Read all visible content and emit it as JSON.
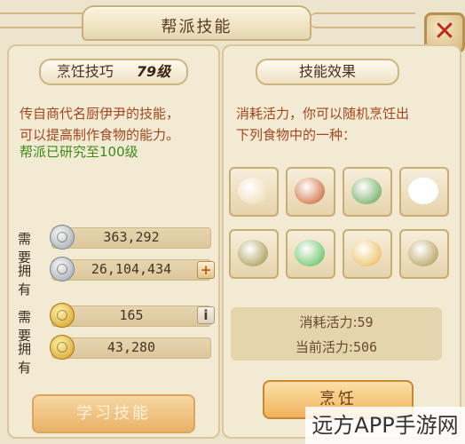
{
  "window": {
    "title": "帮派技能",
    "close_label": "✕"
  },
  "left": {
    "skill_name": "烹饪技巧",
    "skill_level": "79级",
    "description": [
      "传自商代名厨伊尹的技能，",
      "可以提高制作食物的能力。"
    ],
    "research": "帮派已研究至100级",
    "resources": [
      {
        "label": "需要",
        "value": "363,292",
        "coin": "silver-coin-icon"
      },
      {
        "label": "拥有",
        "value": "26,104,434",
        "coin": "silver-coin-icon",
        "action": "+"
      },
      {
        "label": "需要",
        "value": "165",
        "coin": "gold-coin-icon",
        "action": "i"
      },
      {
        "label": "拥有",
        "value": "43,280",
        "coin": "gold-coin-icon"
      }
    ],
    "learn_button": "学习技能"
  },
  "right": {
    "effect_title": "技能效果",
    "description": [
      "消耗活力，你可以随机烹饪出",
      "下列食物中的一种："
    ],
    "foods": [
      {
        "icon": "steamed-bun-food-icon",
        "color": "#efd7a8"
      },
      {
        "icon": "braised-meat-food-icon",
        "color": "#c8541d"
      },
      {
        "icon": "dumpling-dish-food-icon",
        "color": "#5aa145"
      },
      {
        "icon": "rice-ball-food-icon",
        "color": "#ffffff"
      },
      {
        "icon": "bronze-vessel-food-icon",
        "color": "#9c8a3a"
      },
      {
        "icon": "green-jelly-food-icon",
        "color": "#4fb84a"
      },
      {
        "icon": "noodle-bowl-food-icon",
        "color": "#e8b548"
      },
      {
        "icon": "bronze-cup-food-icon",
        "color": "#a99044"
      }
    ],
    "stats": {
      "cost_label": "消耗活力:",
      "cost_value": "59",
      "current_label": "当前活力:",
      "current_value": "506"
    },
    "cook_button": "烹饪"
  },
  "watermark": "远方APP手游网"
}
